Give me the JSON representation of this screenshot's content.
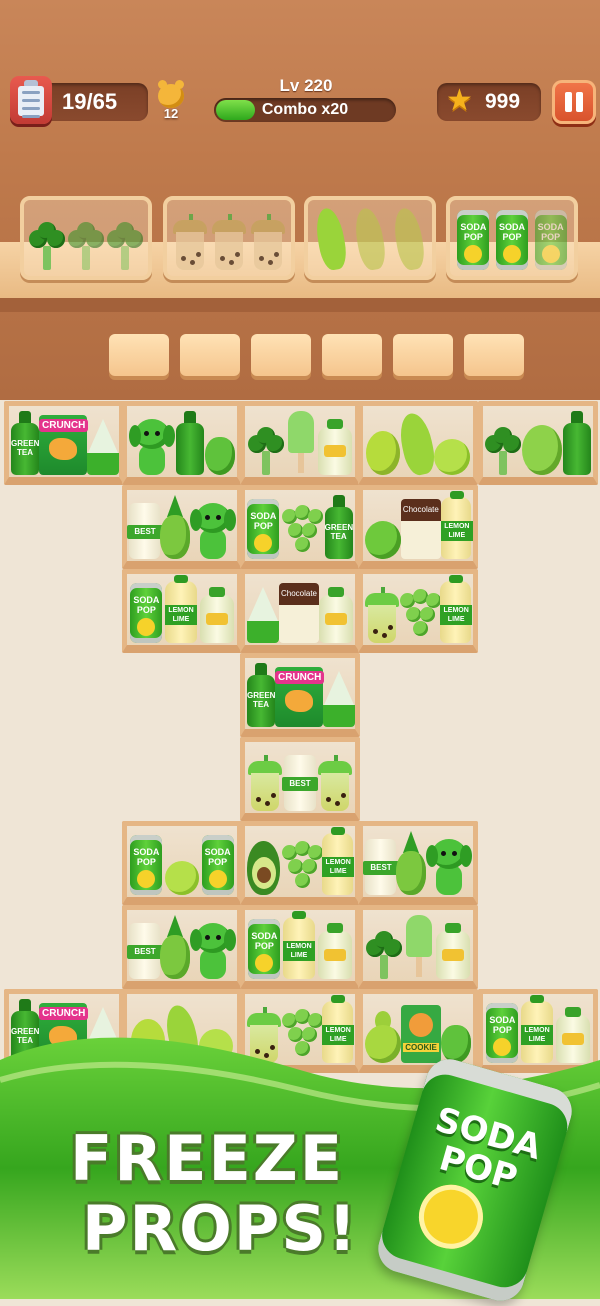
{
  "hud": {
    "task_progress": "19/65",
    "bear_count": "12",
    "level": "Lv 220",
    "combo_label": "Combo x20",
    "combo_fill": 0.22,
    "coins": "999"
  },
  "bins": [
    {
      "item": "broccoli"
    },
    {
      "item": "bubble-tea"
    },
    {
      "item": "banana"
    },
    {
      "item": "soda-can",
      "label": "SODA POP"
    }
  ],
  "slots": 6,
  "labels": {
    "soda": "SODA POP",
    "green_tea": "GREEN TEA",
    "crunch": "CRUNCH",
    "best": "BEST",
    "lemon": "LEMON LIME",
    "chocolate": "Chocolate",
    "cookie": "COOKIE"
  },
  "banner": {
    "line1": "FREEZE",
    "line2": "PROPS!",
    "can_label": "SODA POP"
  },
  "colors": {
    "wood": "#bf7a4c",
    "shelf": "#f3d6ad",
    "accent_green": "#2fae3c"
  }
}
